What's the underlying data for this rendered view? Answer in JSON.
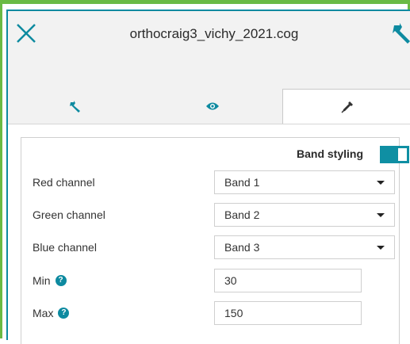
{
  "header": {
    "title": "orthocraig3_vichy_2021.cog",
    "close_icon": "close-icon",
    "settings_icon": "wrench-icon"
  },
  "tabs": [
    {
      "icon": "wrench-icon",
      "active": false
    },
    {
      "icon": "eye-icon",
      "active": false
    },
    {
      "icon": "eyedropper-icon",
      "active": true
    }
  ],
  "band_styling": {
    "label": "Band styling",
    "enabled": true
  },
  "channels": {
    "red": {
      "label": "Red channel",
      "value": "Band 1"
    },
    "green": {
      "label": "Green channel",
      "value": "Band 2"
    },
    "blue": {
      "label": "Blue channel",
      "value": "Band 3"
    }
  },
  "range": {
    "min": {
      "label": "Min",
      "value": "30"
    },
    "max": {
      "label": "Max",
      "value": "150"
    }
  },
  "colors": {
    "accent": "#0d8aa0",
    "frame": "#6aba44",
    "header_bg": "#f2f2f2"
  }
}
